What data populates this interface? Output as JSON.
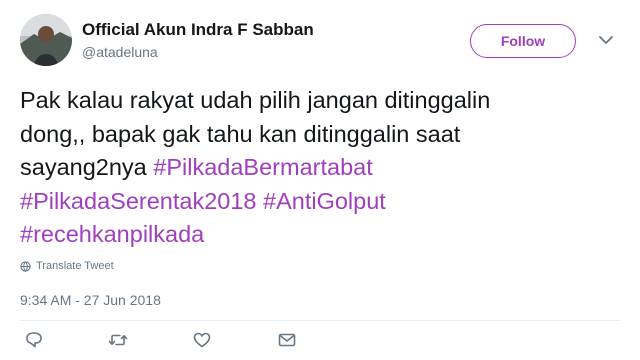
{
  "user": {
    "display_name": "Official Akun Indra F Sabban",
    "handle": "@atadeluna"
  },
  "follow_label": "Follow",
  "tweet": {
    "lines": [
      [
        {
          "text": "Pak kalau rakyat udah pilih jangan ditinggalin",
          "hashtag": false
        }
      ],
      [
        {
          "text": "dong,, bapak gak tahu kan ditinggalin saat",
          "hashtag": false
        }
      ],
      [
        {
          "text": "sayang2nya ",
          "hashtag": false
        },
        {
          "text": "#PilkadaBermartabat",
          "hashtag": true
        }
      ],
      [
        {
          "text": "#PilkadaSerentak2018",
          "hashtag": true
        },
        {
          "text": " ",
          "hashtag": false
        },
        {
          "text": "#AntiGolput",
          "hashtag": true
        }
      ],
      [
        {
          "text": "#recehkanpilkada",
          "hashtag": true
        }
      ]
    ]
  },
  "translate_label": "Translate Tweet",
  "timestamp": "9:34 AM - 27 Jun 2018",
  "icons": {
    "reply": "reply-icon",
    "retweet": "retweet-icon",
    "like": "heart-icon",
    "dm": "envelope-icon",
    "more": "chevron-down-icon",
    "translate": "globe-icon"
  },
  "colors": {
    "accent": "#9f3fbf",
    "text": "#14171a",
    "muted": "#657786"
  }
}
